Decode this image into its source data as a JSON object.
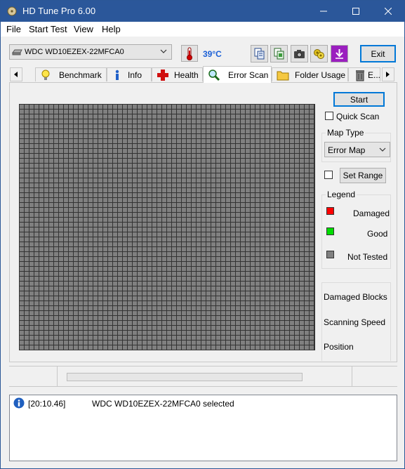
{
  "window": {
    "title": "HD Tune Pro 6.00",
    "controls": {
      "minimize": "—",
      "maximize": "☐",
      "close": "✕"
    }
  },
  "menu": [
    "File",
    "Start Test",
    "View",
    "Help"
  ],
  "toolbar": {
    "drive": "WDC WD10EZEX-22MFCA0",
    "temperature": "39°C",
    "exit_label": "Exit",
    "tools": [
      "copy-text-icon",
      "copy-screen-icon",
      "camera-icon",
      "options-icon",
      "download-icon"
    ]
  },
  "tabs": [
    {
      "label": "Benchmark",
      "icon": "lightbulb-icon"
    },
    {
      "label": "Info",
      "icon": "info-icon"
    },
    {
      "label": "Health",
      "icon": "health-cross-icon"
    },
    {
      "label": "Error Scan",
      "icon": "magnifier-icon",
      "active": true
    },
    {
      "label": "Folder Usage",
      "icon": "folder-icon"
    },
    {
      "label": "E...",
      "icon": "trash-icon"
    }
  ],
  "error_scan": {
    "start_label": "Start",
    "quick_scan_label": "Quick Scan",
    "quick_scan_checked": false,
    "map_type_title": "Map Type",
    "map_type_value": "Error Map",
    "set_range_checked": false,
    "set_range_label": "Set Range",
    "legend_title": "Legend",
    "legend": [
      {
        "label": "Damaged",
        "color": "#ff0000"
      },
      {
        "label": "Good",
        "color": "#00dd00"
      },
      {
        "label": "Not Tested",
        "color": "#808080"
      }
    ],
    "stats": {
      "damaged_blocks_label": "Damaged Blocks",
      "scanning_speed_label": "Scanning Speed",
      "position_label": "Position"
    },
    "block_color": "#808080",
    "block_border_color": "#333333"
  },
  "status": {
    "progress": 0
  },
  "log": [
    {
      "time": "[20:10.46]",
      "message": "WDC WD10EZEX-22MFCA0 selected"
    }
  ]
}
